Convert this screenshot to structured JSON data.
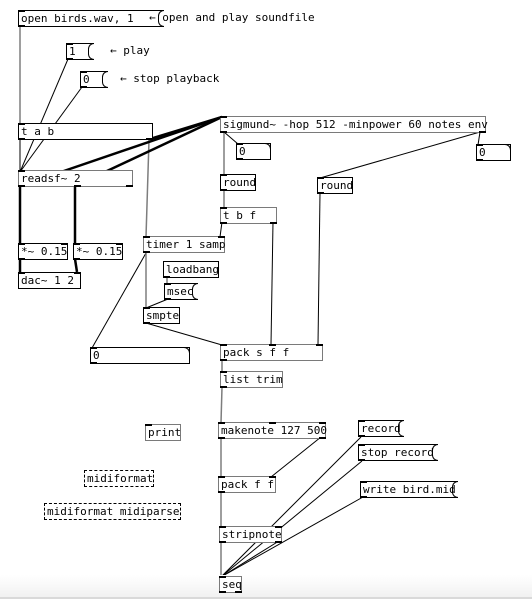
{
  "patch": {
    "messages": {
      "open": "open birds.wav, 1",
      "play": "1",
      "stop": "0",
      "msec": "msec",
      "record": "record",
      "stop_record": "stop record",
      "write": "write bird.mid"
    },
    "comments": {
      "open": "← open and play soundfile",
      "play": "← play",
      "stop": "← stop playback"
    },
    "objects": {
      "tab": "t a b",
      "readsf": "readsf~ 2",
      "mul_left": "*~ 0.15",
      "mul_right": "*~ 0.15",
      "dac": "dac~ 1 2",
      "sigmund": "sigmund~ -hop 512 -minpower 60 notes env",
      "round_notes": "round",
      "round_env": "round",
      "tbf": "t b f",
      "timer": "timer 1 samp",
      "loadbang": "loadbang",
      "smpte": "smpte",
      "pack_sff": "pack s f f",
      "list_trim": "list trim",
      "print": "print",
      "makenote": "makenote 127 500",
      "pack_ff": "pack f f",
      "stripnote": "stripnote",
      "seq": "seq",
      "midiformat": "midiformat",
      "midiformat_midiparse": "midiformat midiparse"
    },
    "numbers": {
      "sigmund_notes": "0",
      "sigmund_env": "0",
      "smpte_out": "0"
    }
  }
}
